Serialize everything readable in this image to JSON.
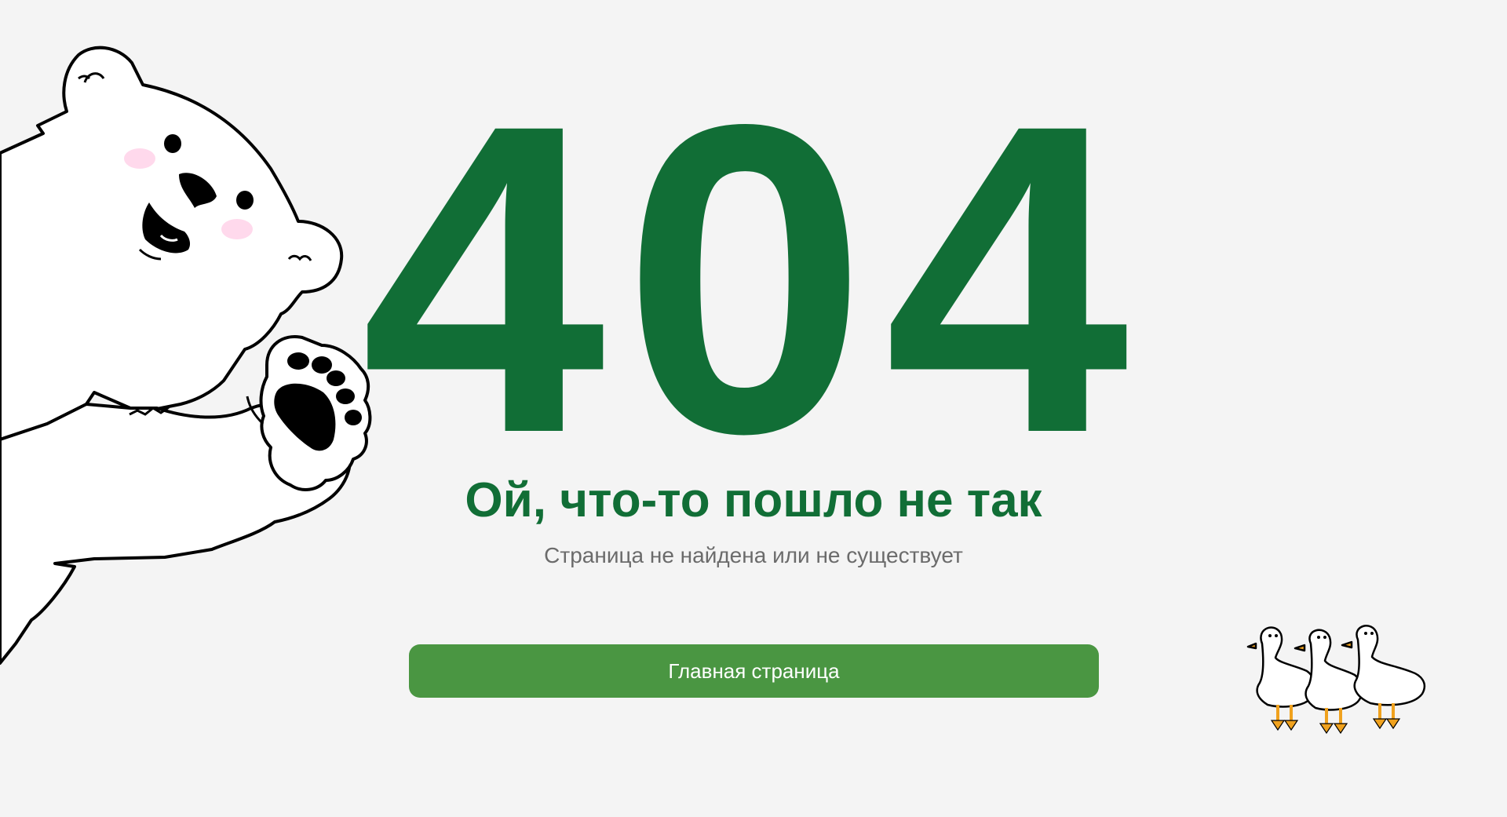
{
  "error": {
    "code": "404",
    "heading": "Ой, что-то пошло не так",
    "subheading": "Страница не найдена или не существует"
  },
  "actions": {
    "home_label": "Главная страница"
  },
  "colors": {
    "background": "#f4f4f4",
    "primary_green": "#116e36",
    "button_green": "#4a9642",
    "subtext_gray": "#6b6b6b"
  },
  "illustrations": {
    "left": "polar-bear-illustration",
    "right": "geese-illustration"
  }
}
